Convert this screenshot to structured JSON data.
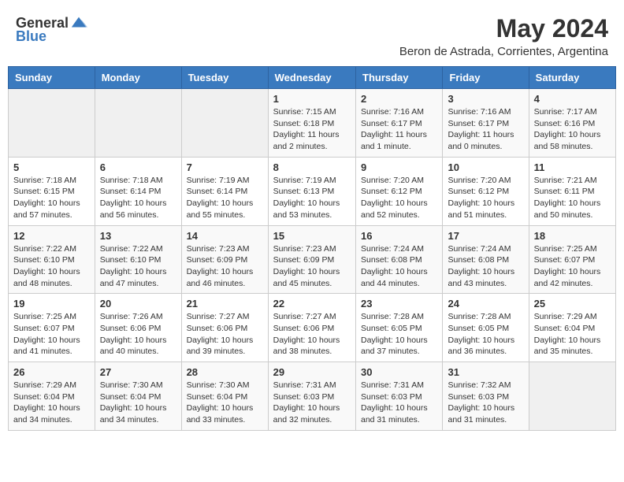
{
  "header": {
    "logo_general": "General",
    "logo_blue": "Blue",
    "month_year": "May 2024",
    "location": "Beron de Astrada, Corrientes, Argentina"
  },
  "weekdays": [
    "Sunday",
    "Monday",
    "Tuesday",
    "Wednesday",
    "Thursday",
    "Friday",
    "Saturday"
  ],
  "weeks": [
    [
      {
        "day": "",
        "info": ""
      },
      {
        "day": "",
        "info": ""
      },
      {
        "day": "",
        "info": ""
      },
      {
        "day": "1",
        "info": "Sunrise: 7:15 AM\nSunset: 6:18 PM\nDaylight: 11 hours and 2 minutes."
      },
      {
        "day": "2",
        "info": "Sunrise: 7:16 AM\nSunset: 6:17 PM\nDaylight: 11 hours and 1 minute."
      },
      {
        "day": "3",
        "info": "Sunrise: 7:16 AM\nSunset: 6:17 PM\nDaylight: 11 hours and 0 minutes."
      },
      {
        "day": "4",
        "info": "Sunrise: 7:17 AM\nSunset: 6:16 PM\nDaylight: 10 hours and 58 minutes."
      }
    ],
    [
      {
        "day": "5",
        "info": "Sunrise: 7:18 AM\nSunset: 6:15 PM\nDaylight: 10 hours and 57 minutes."
      },
      {
        "day": "6",
        "info": "Sunrise: 7:18 AM\nSunset: 6:14 PM\nDaylight: 10 hours and 56 minutes."
      },
      {
        "day": "7",
        "info": "Sunrise: 7:19 AM\nSunset: 6:14 PM\nDaylight: 10 hours and 55 minutes."
      },
      {
        "day": "8",
        "info": "Sunrise: 7:19 AM\nSunset: 6:13 PM\nDaylight: 10 hours and 53 minutes."
      },
      {
        "day": "9",
        "info": "Sunrise: 7:20 AM\nSunset: 6:12 PM\nDaylight: 10 hours and 52 minutes."
      },
      {
        "day": "10",
        "info": "Sunrise: 7:20 AM\nSunset: 6:12 PM\nDaylight: 10 hours and 51 minutes."
      },
      {
        "day": "11",
        "info": "Sunrise: 7:21 AM\nSunset: 6:11 PM\nDaylight: 10 hours and 50 minutes."
      }
    ],
    [
      {
        "day": "12",
        "info": "Sunrise: 7:22 AM\nSunset: 6:10 PM\nDaylight: 10 hours and 48 minutes."
      },
      {
        "day": "13",
        "info": "Sunrise: 7:22 AM\nSunset: 6:10 PM\nDaylight: 10 hours and 47 minutes."
      },
      {
        "day": "14",
        "info": "Sunrise: 7:23 AM\nSunset: 6:09 PM\nDaylight: 10 hours and 46 minutes."
      },
      {
        "day": "15",
        "info": "Sunrise: 7:23 AM\nSunset: 6:09 PM\nDaylight: 10 hours and 45 minutes."
      },
      {
        "day": "16",
        "info": "Sunrise: 7:24 AM\nSunset: 6:08 PM\nDaylight: 10 hours and 44 minutes."
      },
      {
        "day": "17",
        "info": "Sunrise: 7:24 AM\nSunset: 6:08 PM\nDaylight: 10 hours and 43 minutes."
      },
      {
        "day": "18",
        "info": "Sunrise: 7:25 AM\nSunset: 6:07 PM\nDaylight: 10 hours and 42 minutes."
      }
    ],
    [
      {
        "day": "19",
        "info": "Sunrise: 7:25 AM\nSunset: 6:07 PM\nDaylight: 10 hours and 41 minutes."
      },
      {
        "day": "20",
        "info": "Sunrise: 7:26 AM\nSunset: 6:06 PM\nDaylight: 10 hours and 40 minutes."
      },
      {
        "day": "21",
        "info": "Sunrise: 7:27 AM\nSunset: 6:06 PM\nDaylight: 10 hours and 39 minutes."
      },
      {
        "day": "22",
        "info": "Sunrise: 7:27 AM\nSunset: 6:06 PM\nDaylight: 10 hours and 38 minutes."
      },
      {
        "day": "23",
        "info": "Sunrise: 7:28 AM\nSunset: 6:05 PM\nDaylight: 10 hours and 37 minutes."
      },
      {
        "day": "24",
        "info": "Sunrise: 7:28 AM\nSunset: 6:05 PM\nDaylight: 10 hours and 36 minutes."
      },
      {
        "day": "25",
        "info": "Sunrise: 7:29 AM\nSunset: 6:04 PM\nDaylight: 10 hours and 35 minutes."
      }
    ],
    [
      {
        "day": "26",
        "info": "Sunrise: 7:29 AM\nSunset: 6:04 PM\nDaylight: 10 hours and 34 minutes."
      },
      {
        "day": "27",
        "info": "Sunrise: 7:30 AM\nSunset: 6:04 PM\nDaylight: 10 hours and 34 minutes."
      },
      {
        "day": "28",
        "info": "Sunrise: 7:30 AM\nSunset: 6:04 PM\nDaylight: 10 hours and 33 minutes."
      },
      {
        "day": "29",
        "info": "Sunrise: 7:31 AM\nSunset: 6:03 PM\nDaylight: 10 hours and 32 minutes."
      },
      {
        "day": "30",
        "info": "Sunrise: 7:31 AM\nSunset: 6:03 PM\nDaylight: 10 hours and 31 minutes."
      },
      {
        "day": "31",
        "info": "Sunrise: 7:32 AM\nSunset: 6:03 PM\nDaylight: 10 hours and 31 minutes."
      },
      {
        "day": "",
        "info": ""
      }
    ]
  ]
}
